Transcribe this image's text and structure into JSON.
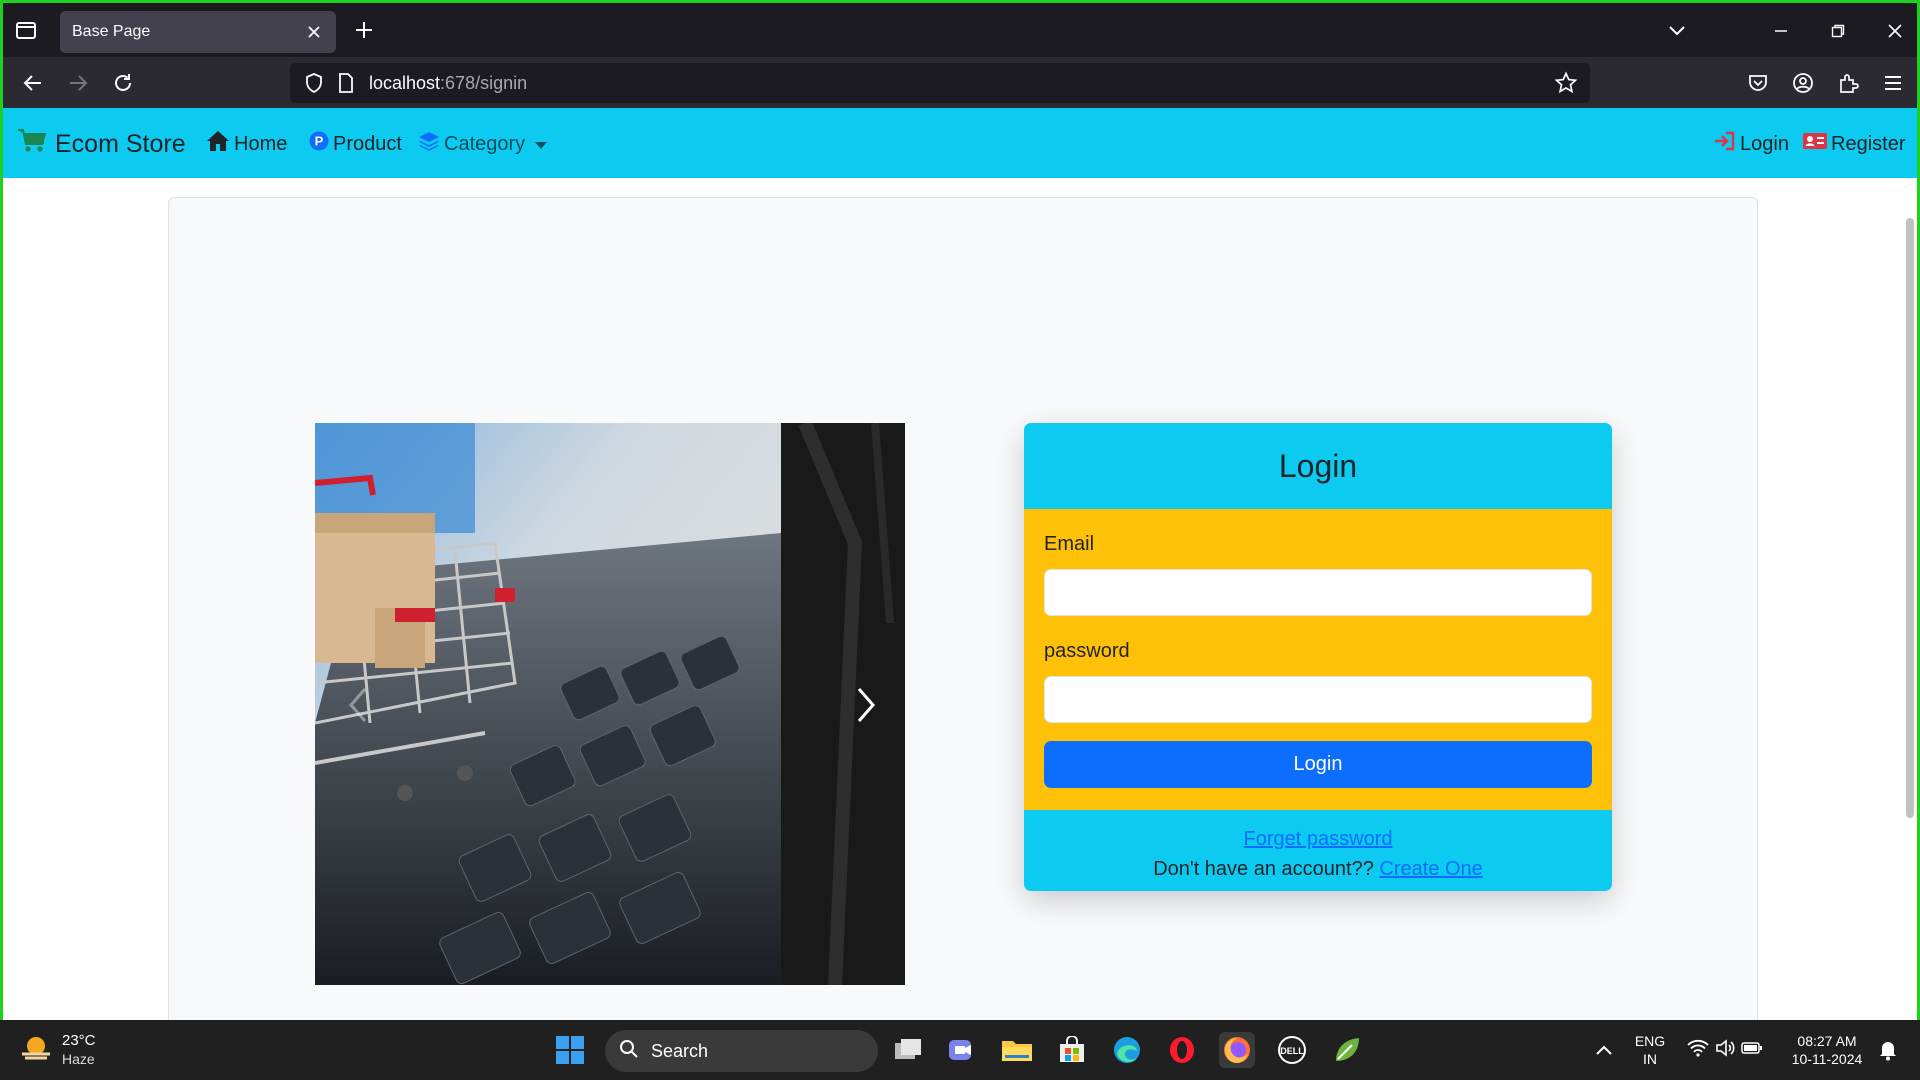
{
  "browser": {
    "tab_title": "Base Page",
    "url_host": "localhost",
    "url_path": ":678/signin"
  },
  "site": {
    "brand": "Ecom Store",
    "nav": {
      "home": "Home",
      "product": "Product",
      "category": "Category",
      "login": "Login",
      "register": "Register"
    }
  },
  "login_card": {
    "title": "Login",
    "email_label": "Email",
    "email_value": "",
    "password_label": "password",
    "password_value": "",
    "submit_label": "Login",
    "forgot_link": "Forget password",
    "signup_prompt": "Don't have an account??",
    "signup_link": "Create One"
  },
  "taskbar": {
    "weather_temp": "23°C",
    "weather_desc": "Haze",
    "search_label": "Search",
    "lang_line1": "ENG",
    "lang_line2": "IN",
    "time": "08:27 AM",
    "date": "10-11-2024"
  },
  "colors": {
    "navbar": "#0dcaf0",
    "card_body": "#ffc107",
    "primary": "#0d6efd",
    "frame": "#1fd11f"
  }
}
